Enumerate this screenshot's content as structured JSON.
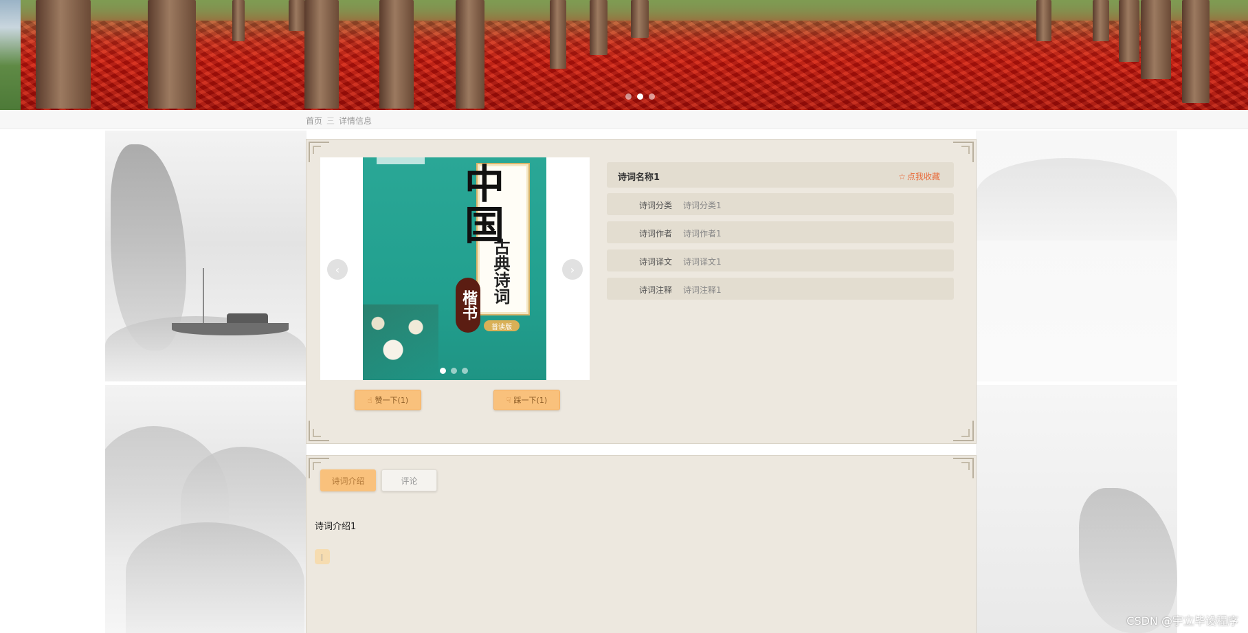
{
  "breadcrumb": {
    "home": "首页",
    "separator": "三",
    "current": "详情信息"
  },
  "carousel": {
    "prev_icon": "chevron-left-icon",
    "next_icon": "chevron-right-icon",
    "dot_count": 3,
    "active_dot": 0
  },
  "book_cover": {
    "title": "中国",
    "subtitle": "古典诗词",
    "seal": "楷书",
    "badge": "普读版"
  },
  "votes": {
    "like_label": "赞一下(1)",
    "dislike_label": "踩一下(1)",
    "like_icon": "thumbs-up-icon",
    "dislike_icon": "thumbs-down-icon"
  },
  "poem": {
    "name": "诗词名称1",
    "favorite_label": "点我收藏",
    "favorite_icon": "star-icon",
    "fields": [
      {
        "label": "诗词分类",
        "value": "诗词分类1"
      },
      {
        "label": "诗词作者",
        "value": "诗词作者1"
      },
      {
        "label": "诗词译文",
        "value": "诗词译文1"
      },
      {
        "label": "诗词注释",
        "value": "诗词注释1"
      }
    ]
  },
  "tabs": {
    "intro_label": "诗词介绍",
    "comment_label": "评论"
  },
  "intro": {
    "text": "诗词介绍1"
  },
  "watermark": "CSDN @宇立毕设程序",
  "colors": {
    "accent": "#f9c17c",
    "panel_bg": "#ede8df",
    "row_bg": "#e3ddd0",
    "favorite": "#e86a3a"
  }
}
